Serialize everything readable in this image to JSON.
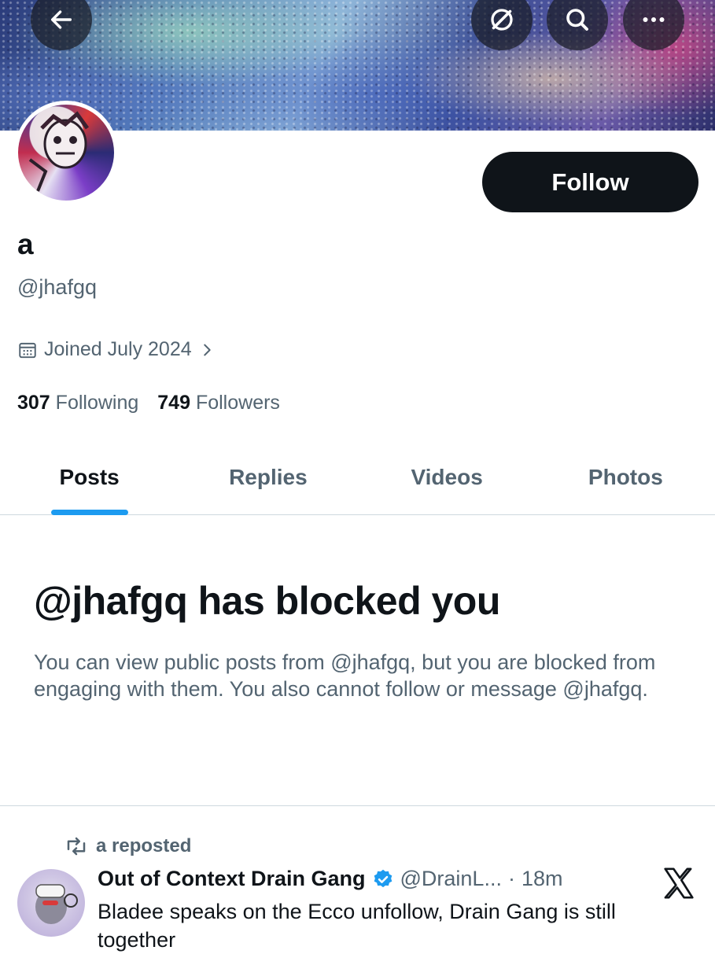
{
  "header": {
    "back_icon": "arrow-left-icon",
    "action_icons": [
      "grok-icon",
      "search-icon",
      "more-icon"
    ]
  },
  "profile": {
    "display_name": "a",
    "handle": "@jhafgq",
    "joined": "Joined July 2024",
    "following_count": "307",
    "following_label": "Following",
    "followers_count": "749",
    "followers_label": "Followers",
    "follow_label": "Follow"
  },
  "tabs": [
    {
      "label": "Posts",
      "active": true
    },
    {
      "label": "Replies",
      "active": false
    },
    {
      "label": "Videos",
      "active": false
    },
    {
      "label": "Photos",
      "active": false
    }
  ],
  "blocked": {
    "title": "@jhafgq has blocked you",
    "body": "You can view public posts from @jhafgq, but you are blocked from engaging with them. You also cannot follow or message @jhafgq."
  },
  "post": {
    "repost_label": "a reposted",
    "author_name": "Out of Context Drain Gang",
    "author_handle": "@DrainL...",
    "separator": "·",
    "time": "18m",
    "text": "Bladee speaks on the Ecco unfollow, Drain Gang is still together"
  },
  "colors": {
    "accent": "#1d9bf0",
    "text_primary": "#0f1419",
    "text_secondary": "#536471",
    "border": "#cfd9de"
  }
}
